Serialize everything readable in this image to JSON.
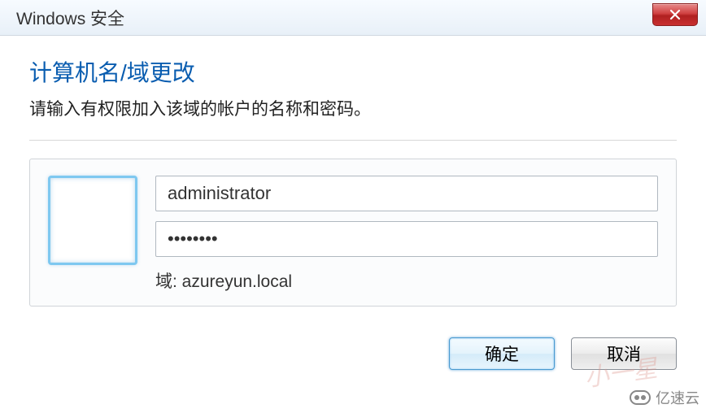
{
  "titlebar": {
    "title": "Windows 安全"
  },
  "dialog": {
    "heading": "计算机名/域更改",
    "subheading": "请输入有权限加入该域的帐户的名称和密码。",
    "username_value": "administrator",
    "password_value": "••••••••",
    "domain_label": "域: azureyun.local"
  },
  "buttons": {
    "ok": "确定",
    "cancel": "取消"
  },
  "watermark": {
    "text": "亿速云"
  }
}
